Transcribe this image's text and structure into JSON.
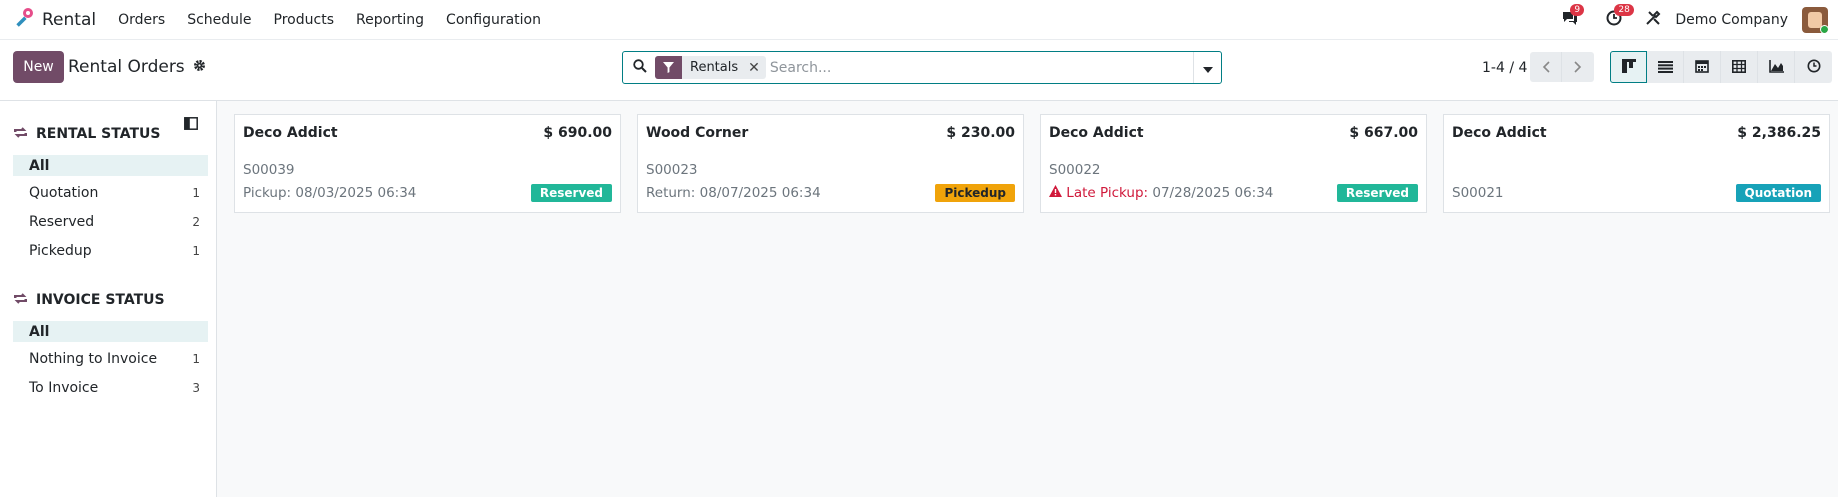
{
  "app": {
    "name": "Rental"
  },
  "menu": [
    "Orders",
    "Schedule",
    "Products",
    "Reporting",
    "Configuration"
  ],
  "systray": {
    "messages_count": "9",
    "activities_count": "28",
    "company": "Demo Company"
  },
  "control": {
    "new_label": "New",
    "title": "Rental Orders",
    "facet_value": "Rentals",
    "search_placeholder": "Search...",
    "pager": "1-4 / 4"
  },
  "views": [
    "kanban",
    "list",
    "calendar",
    "pivot",
    "graph",
    "activity"
  ],
  "sidebar": {
    "rental_status": {
      "title": "RENTAL STATUS",
      "items": [
        {
          "label": "All",
          "count": ""
        },
        {
          "label": "Quotation",
          "count": "1"
        },
        {
          "label": "Reserved",
          "count": "2"
        },
        {
          "label": "Pickedup",
          "count": "1"
        }
      ]
    },
    "invoice_status": {
      "title": "INVOICE STATUS",
      "items": [
        {
          "label": "All",
          "count": ""
        },
        {
          "label": "Nothing to Invoice",
          "count": "1"
        },
        {
          "label": "To Invoice",
          "count": "3"
        }
      ]
    }
  },
  "cards": [
    {
      "partner": "Deco Addict",
      "amount": "$ 690.00",
      "ref": "S00039",
      "date_label": "Pickup:",
      "date": "08/03/2025 06:34",
      "late": false,
      "status": "Reserved",
      "status_color": "#21b799"
    },
    {
      "partner": "Wood Corner",
      "amount": "$ 230.00",
      "ref": "S00023",
      "date_label": "Return:",
      "date": "08/07/2025 06:34",
      "late": false,
      "status": "Pickedup",
      "status_color": "#f0a30a"
    },
    {
      "partner": "Deco Addict",
      "amount": "$ 667.00",
      "ref": "S00022",
      "date_label": "Late Pickup:",
      "date": "07/28/2025 06:34",
      "late": true,
      "status": "Reserved",
      "status_color": "#21b799"
    },
    {
      "partner": "Deco Addict",
      "amount": "$ 2,386.25",
      "ref": "S00021",
      "date_label": "",
      "date": "",
      "late": false,
      "status": "Quotation",
      "status_color": "#17a2b8"
    }
  ]
}
